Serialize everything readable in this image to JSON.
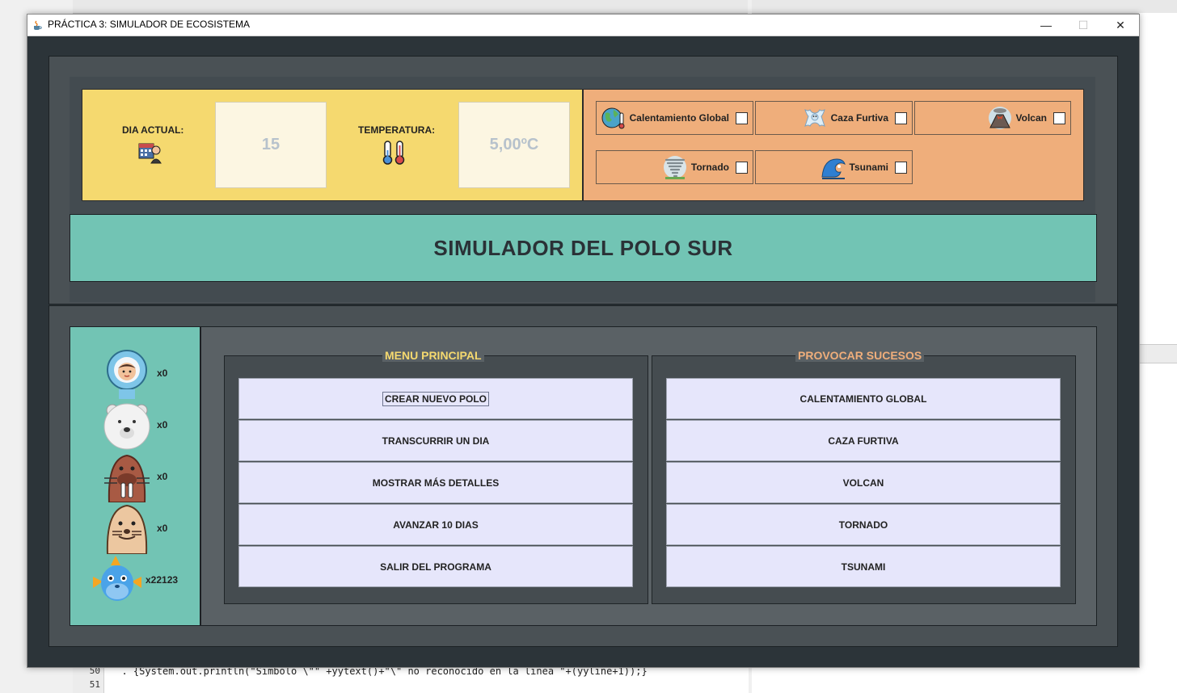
{
  "window": {
    "title": "PRÁCTICA 3: SIMULADOR DE ECOSISTEMA",
    "minimize_glyph": "—",
    "maximize_glyph": "☐",
    "close_glyph": "✕"
  },
  "status": {
    "day_label": "DIA ACTUAL:",
    "day_value": "15",
    "temperature_label": "TEMPERATURA:",
    "temperature_value": "5,00ºC",
    "calendar_icon": "calendar-person-icon",
    "thermometer_icon": "thermometer-icon"
  },
  "events": [
    {
      "label": "Calentamiento Global",
      "icon": "globe-thermometer-icon",
      "checked": false
    },
    {
      "label": "Caza Furtiva",
      "icon": "polar-bear-skin-icon",
      "checked": false
    },
    {
      "label": "Volcan",
      "icon": "volcano-icon",
      "checked": false
    },
    {
      "label": "Tornado",
      "icon": "tornado-icon",
      "checked": false
    },
    {
      "label": "Tsunami",
      "icon": "wave-icon",
      "checked": false
    }
  ],
  "banner": {
    "title": "SIMULADOR DEL POLO SUR"
  },
  "animals": [
    {
      "name": "inuit",
      "icon": "eskimo-icon",
      "count": "x0"
    },
    {
      "name": "polar-bear",
      "icon": "polar-bear-icon",
      "count": "x0"
    },
    {
      "name": "walrus",
      "icon": "walrus-icon",
      "count": "x0"
    },
    {
      "name": "seal",
      "icon": "seal-icon",
      "count": "x0"
    },
    {
      "name": "fish",
      "icon": "fish-icon",
      "count": "x22123"
    }
  ],
  "menu_principal": {
    "legend": "MENU PRINCIPAL",
    "legend_color": "#f5d96f",
    "buttons": [
      "CREAR NUEVO POLO",
      "TRANSCURRIR UN DIA",
      "MOSTRAR MÁS DETALLES",
      "AVANZAR 10 DIAS",
      "SALIR DEL PROGRAMA"
    ]
  },
  "provocar_sucesos": {
    "legend": "PROVOCAR SUCESOS",
    "legend_color": "#efae7b",
    "buttons": [
      "CALENTAMIENTO GLOBAL",
      "CAZA FURTIVA",
      "VOLCAN",
      "TORNADO",
      "TSUNAMI"
    ]
  },
  "background_editor": {
    "line_numbers": [
      "50",
      "51"
    ],
    "code_line": "  . {System.out.println(\"Simbolo \\\"\" +yytext()+\"\\\" no reconocido en la linea \"+(yyline+1));}"
  },
  "colors": {
    "window_bg": "#2c3439",
    "info_yellow": "#f5d96f",
    "events_orange": "#efae7b",
    "banner_teal": "#72c4b4",
    "button_lavender": "#e6e6fb"
  }
}
